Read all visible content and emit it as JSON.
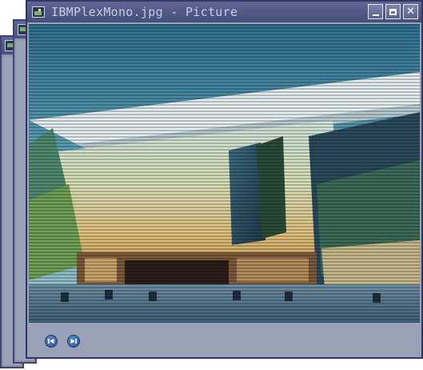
{
  "window": {
    "title": "IBMPlexMono.jpg - Picture",
    "controls": {
      "minimize": "minimize",
      "maximize": "maximize",
      "close": "✕"
    }
  },
  "background_windows": 2,
  "picture": {
    "content": "photo of a modern glass building at dusk"
  },
  "footer": {
    "prev_icon": "skip-back-icon",
    "next_icon": "skip-forward-icon"
  },
  "colors": {
    "titlebar": "#4a527f",
    "title_text": "#c7cbdf",
    "window_body": "#9aa1b6",
    "nav_button": "#2f63a8"
  }
}
